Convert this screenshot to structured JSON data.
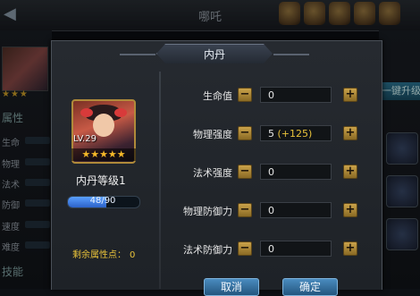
{
  "background": {
    "top_title": "哪吒",
    "back_glyph": "◀",
    "left_section_attr": "属性",
    "left_section_skill": "技能",
    "left_stats": [
      "生命",
      "物理",
      "法术",
      "防御",
      "速度",
      "难度"
    ],
    "left_stars": "★★★",
    "onekey_button": "一键升级",
    "top_icons": [
      "scroll-icon",
      "coin-icon",
      "bag-icon",
      "card-icon",
      "book-icon"
    ]
  },
  "dialog": {
    "title": "内丹",
    "hero": {
      "level_label": "LV.29",
      "stars": "★★★★★",
      "star_count": 5
    },
    "dan_level": "内丹等级1",
    "exp": {
      "current": 48,
      "max": 90,
      "text_current": "48",
      "text_sep": "/",
      "text_max": "90"
    },
    "remain_label": "剩余属性点：",
    "remain_value": "0",
    "stats": [
      {
        "label": "生命值",
        "value": "0",
        "bonus": ""
      },
      {
        "label": "物理强度",
        "value": "5",
        "bonus": " (+125)"
      },
      {
        "label": "法术强度",
        "value": "0",
        "bonus": ""
      },
      {
        "label": "物理防御力",
        "value": "0",
        "bonus": ""
      },
      {
        "label": "法术防御力",
        "value": "0",
        "bonus": ""
      }
    ],
    "minus_glyph": "−",
    "plus_glyph": "+",
    "cancel_label": "取消",
    "confirm_label": "确定"
  },
  "colors": {
    "gold": "#e8c23a",
    "button_blue": "#23557e",
    "exp_blue": "#2c62c8"
  }
}
